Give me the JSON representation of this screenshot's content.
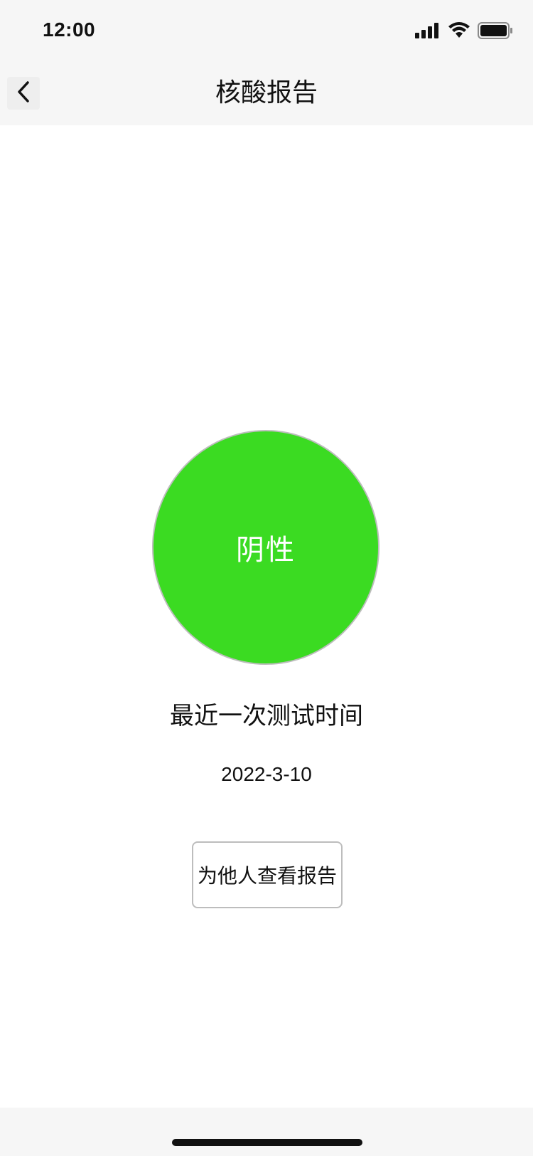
{
  "status_bar": {
    "time": "12:00",
    "icons": [
      "cellular-signal-icon",
      "wifi-icon",
      "battery-icon"
    ]
  },
  "nav": {
    "back_icon": "chevron-left-icon",
    "title": "核酸报告"
  },
  "result": {
    "status": "阴性",
    "color": "#3bdb22"
  },
  "last_test": {
    "label": "最近一次测试时间",
    "date": "2022-3-10"
  },
  "actions": {
    "check_others_label": "为他人查看报告"
  }
}
